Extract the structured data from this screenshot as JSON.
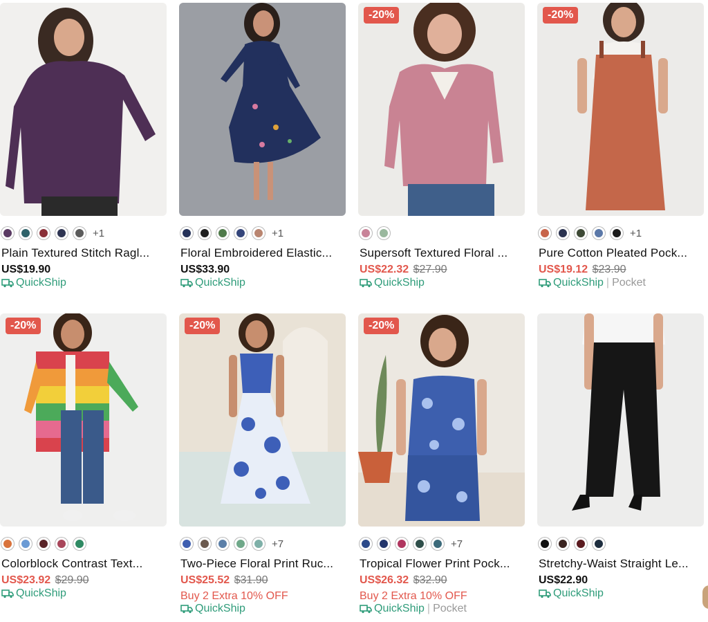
{
  "products": [
    {
      "name": "Plain Textured Stitch Ragl...",
      "price": "US$19.90",
      "sale": false,
      "original_price": "",
      "badge": "",
      "colors": [
        "#5a3a63",
        "#2f6269",
        "#8a3038",
        "#2e3452",
        "#5b5b5b"
      ],
      "more_colors": "+1",
      "quickship": "QuickShip",
      "extra_tag": "",
      "promo": ""
    },
    {
      "name": "Floral Embroidered Elastic...",
      "price": "US$33.90",
      "sale": false,
      "original_price": "",
      "badge": "",
      "colors": [
        "#253259",
        "#1f1f1f",
        "#4f7a4a",
        "#34457a",
        "#b98570"
      ],
      "more_colors": "+1",
      "quickship": "QuickShip",
      "extra_tag": "",
      "promo": ""
    },
    {
      "name": "Supersoft Textured Floral ...",
      "price": "US$22.32",
      "sale": true,
      "original_price": "$27.90",
      "badge": "-20%",
      "colors": [
        "#c88398",
        "#9ab89e"
      ],
      "more_colors": "",
      "quickship": "QuickShip",
      "extra_tag": "",
      "promo": ""
    },
    {
      "name": "Pure Cotton Pleated Pock...",
      "price": "US$19.12",
      "sale": true,
      "original_price": "$23.90",
      "badge": "-20%",
      "colors": [
        "#c7644a",
        "#2b3350",
        "#3e4a36",
        "#5b78a8",
        "#1a1a1a"
      ],
      "more_colors": "+1",
      "quickship": "QuickShip",
      "extra_tag": "Pocket",
      "promo": ""
    },
    {
      "name": "Colorblock Contrast Text...",
      "price": "US$23.92",
      "sale": true,
      "original_price": "$29.90",
      "badge": "-20%",
      "colors": [
        "#d9733c",
        "#6a9ad4",
        "#5a2428",
        "#a8465a",
        "#2f8a63"
      ],
      "more_colors": "",
      "quickship": "QuickShip",
      "extra_tag": "",
      "promo": ""
    },
    {
      "name": "Two-Piece Floral Print Ruc...",
      "price": "US$25.52",
      "sale": true,
      "original_price": "$31.90",
      "badge": "-20%",
      "colors": [
        "#3f5fb0",
        "#6b5a4f",
        "#5b7fa8",
        "#6fa889",
        "#7fb0a8"
      ],
      "more_colors": "+7",
      "quickship": "QuickShip",
      "extra_tag": "",
      "promo": "Buy 2 Extra 10% OFF"
    },
    {
      "name": "Tropical Flower Print Pock...",
      "price": "US$26.32",
      "sale": true,
      "original_price": "$32.90",
      "badge": "-20%",
      "colors": [
        "#2c4a8a",
        "#22356b",
        "#b0365f",
        "#2f4f4a",
        "#3c6a7a"
      ],
      "more_colors": "+7",
      "quickship": "QuickShip",
      "extra_tag": "Pocket",
      "promo": "Buy 2 Extra 10% OFF"
    },
    {
      "name": "Stretchy-Waist Straight Le...",
      "price": "US$22.90",
      "sale": false,
      "original_price": "",
      "badge": "",
      "colors": [
        "#111111",
        "#3a2420",
        "#5a1a1f",
        "#1e2e3f"
      ],
      "more_colors": "",
      "quickship": "QuickShip",
      "extra_tag": "",
      "promo": ""
    }
  ]
}
